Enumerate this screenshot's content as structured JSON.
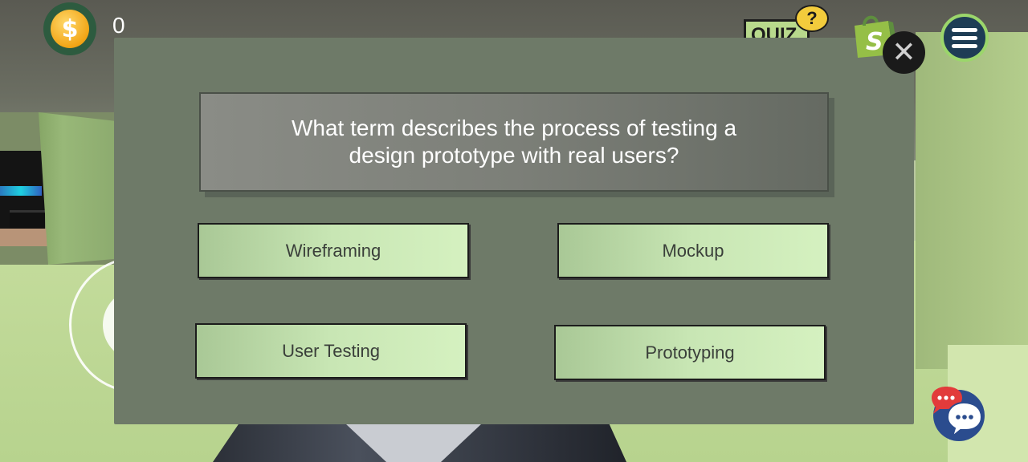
{
  "hud": {
    "coin_symbol": "$",
    "coin_count": "0",
    "quiz_sign_label": "QUIZ",
    "quiz_help_symbol": "?",
    "close_symbol": "✕",
    "icons": [
      "dollar-coin-icon",
      "shopify-bag-icon",
      "close-icon",
      "hamburger-menu-icon",
      "chat-bubbles-icon"
    ]
  },
  "quiz": {
    "question": "What term describes the process of testing a design prototype with real users?",
    "answers": [
      "Wireframing",
      "Mockup",
      "User Testing",
      "Prototyping"
    ]
  },
  "colors": {
    "modal_bg": "#6e7a68",
    "answer_bg": "#c8e6b4",
    "menu_ring": "#9bd66b",
    "coin": "#f2a516",
    "shop": "#95bf47"
  }
}
